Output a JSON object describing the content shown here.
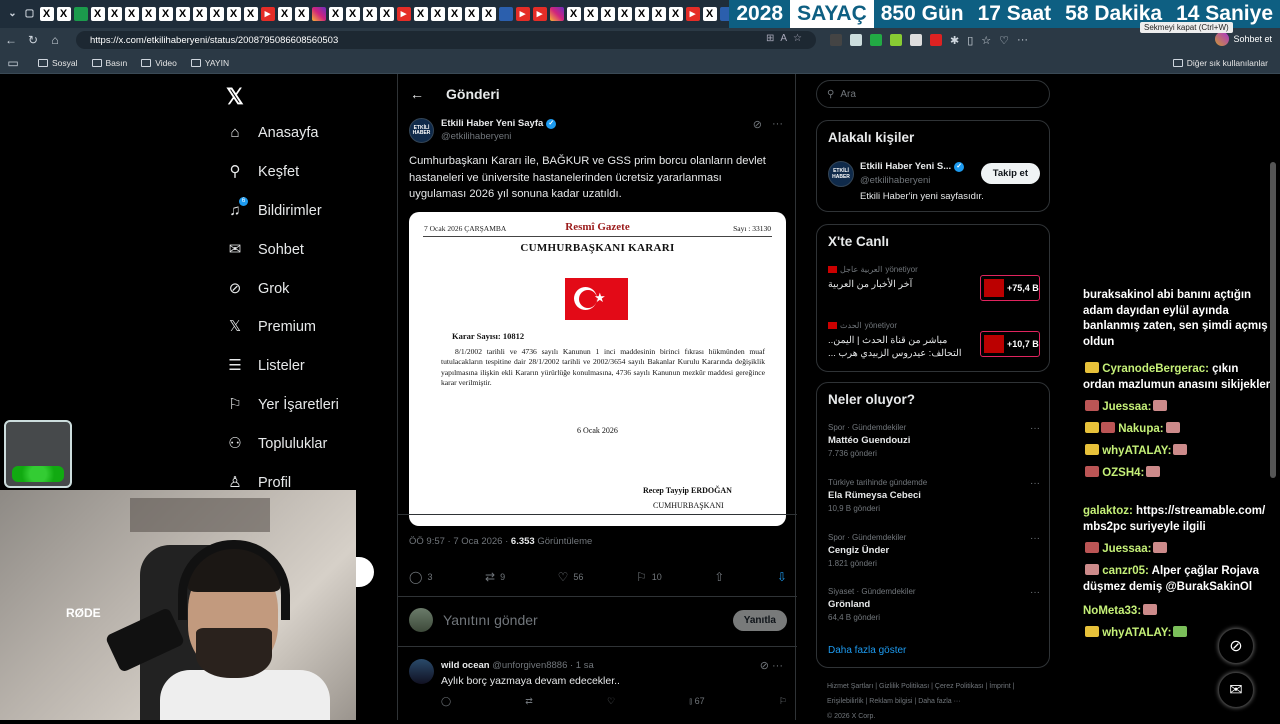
{
  "counter": {
    "year": "2028",
    "label": "SAYAÇ",
    "days": "850 Gün",
    "hours": "17 Saat",
    "minutes": "58 Dakika",
    "seconds": "14 Saniye"
  },
  "browser": {
    "url": "https://x.com/etkilihaberyeni/status/2008795086608560503",
    "tooltip": "Sekmeyi kapat (Ctrl+W)",
    "chat_button": "Sohbet et",
    "bookmarks": [
      "Sosyal",
      "Basın",
      "Video",
      "YAYIN"
    ],
    "other_bookmarks": "Diğer sık kullanılanlar"
  },
  "nav": {
    "items": [
      {
        "label": "Anasayfa",
        "icon": "home-icon"
      },
      {
        "label": "Keşfet",
        "icon": "search-icon"
      },
      {
        "label": "Bildirimler",
        "icon": "bell-icon",
        "badge": "6"
      },
      {
        "label": "Sohbet",
        "icon": "mail-icon"
      },
      {
        "label": "Grok",
        "icon": "grok-icon"
      },
      {
        "label": "Premium",
        "icon": "x-icon"
      },
      {
        "label": "Listeler",
        "icon": "list-icon"
      },
      {
        "label": "Yer İşaretleri",
        "icon": "bookmark-icon"
      },
      {
        "label": "Topluluklar",
        "icon": "people-icon"
      },
      {
        "label": "Profil",
        "icon": "person-icon"
      }
    ]
  },
  "post": {
    "header": "Gönderi",
    "author": "Etkili Haber Yeni Sayfa",
    "handle": "@etkilihaberyeni",
    "avatar_text": "ETKİLİ HABER",
    "text": "Cumhurbaşkanı Kararı ile, BAĞKUR ve GSS prim borcu olanların devlet hastaneleri ve üniversite hastanelerinden ücretsiz yararlanması uygulaması 2026 yıl sonuna kadar uzatıldı.",
    "doc": {
      "date": "7 Ocak 2026 ÇARŞAMBA",
      "gazette": "Resmî Gazete",
      "issue": "Sayı : 33130",
      "title": "CUMHURBAŞKANI KARARI",
      "decision_no": "Karar Sayısı: 10812",
      "body": "8/1/2002 tarihli ve 4736 sayılı Kanunun 1 inci maddesinin birinci fıkrası hükmünden muaf tutulacakların tespitine dair 28/1/2002 tarihli ve 2002/3654 sayılı Bakanlar Kurulu Kararında değişiklik yapılmasına ilişkin ekli Kararın yürürlüğe konulmasına, 4736 sayılı Kanunun mezkûr maddesi gereğince karar verilmiştir.",
      "sign_date": "6 Ocak 2026",
      "signer": "Recep Tayyip ERDOĞAN",
      "signer_title": "CUMHURBAŞKANI"
    },
    "time": "ÖÖ 9:57 · 7 Oca 2026 · ",
    "views_count": "6.353",
    "views_label": " Görüntüleme",
    "replies": "3",
    "reposts": "9",
    "likes": "56",
    "bookmarks": "10",
    "reply_placeholder": "Yanıtını gönder",
    "reply_button": "Yanıtla"
  },
  "comment": {
    "name": "wild ocean",
    "handle": "@unforgiven8886 · 1 sa",
    "text": "Aylık borç yazmaya devam edecekler..",
    "views": "67"
  },
  "sidebar": {
    "search_placeholder": "Ara",
    "people_title": "Alakalı kişiler",
    "person": {
      "name": "Etkili Haber Yeni S...",
      "handle": "@etkilihaberyeni",
      "bio": "Etkili Haber'in yeni sayfasıdır.",
      "follow": "Takip et",
      "avatar_text": "ETKİLİ HABER"
    },
    "live_title": "X'te Canlı",
    "live": [
      {
        "source": "العربية عاجل",
        "status": "yönetiyor",
        "text": "آخر الأخبار من العربية",
        "count": "+75,4 B"
      },
      {
        "source": "الحدث",
        "status": "yönetiyor",
        "text": "مباشر من قناة الحدث | اليمن.. التحالف: عيدروس الزبيدي هرب ...",
        "count": "+10,7 B"
      }
    ],
    "trends_title": "Neler oluyor?",
    "trends": [
      {
        "category": "Spor · Gündemdekiler",
        "name": "Mattéo Guendouzi",
        "posts": "7.736 gönderi"
      },
      {
        "category": "Türkiye tarihinde gündemde",
        "name": "Ela Rümeysa Cebeci",
        "posts": "10,9 B gönderi"
      },
      {
        "category": "Spor · Gündemdekiler",
        "name": "Cengiz Ünder",
        "posts": "1.821 gönderi"
      },
      {
        "category": "Siyaset · Gündemdekiler",
        "name": "Grönland",
        "posts": "64,4 B gönderi"
      }
    ],
    "show_more": "Daha fazla göster",
    "footer": [
      "Hizmet Şartları",
      "Gizlilik Politikası",
      "Çerez Politikası",
      "İmprint",
      "Erişilebilirlik",
      "Reklam bilgisi",
      "Daha fazla ···",
      "© 2026 X Corp."
    ]
  },
  "chat": [
    {
      "user": "",
      "msg": "buraksakinol abi banını açtığın adam dayıdan eylül ayında banlanmış zaten, sen şimdi açmış oldun"
    },
    {
      "user": "CyranodeBergerac:",
      "msg": "çıkın ordan mazlumun anasını sikijekler"
    },
    {
      "user": "Juessaa:",
      "msg": ""
    },
    {
      "user": "Nakupa:",
      "msg": ""
    },
    {
      "user": "whyATALAY:",
      "msg": ""
    },
    {
      "user": "OZSH4:",
      "msg": ""
    },
    {
      "user": "galaktoz:",
      "msg": "https://streamable.com/ mbs2pc suriyeyle ilgili"
    },
    {
      "user": "Juessaa:",
      "msg": ""
    },
    {
      "user": "canzr05:",
      "msg": "Alper çağlar Rojava düşmez demiş @BurakSakinOl"
    },
    {
      "user": "NoMeta33:",
      "msg": ""
    },
    {
      "user": "whyATALAY:",
      "msg": ""
    }
  ]
}
